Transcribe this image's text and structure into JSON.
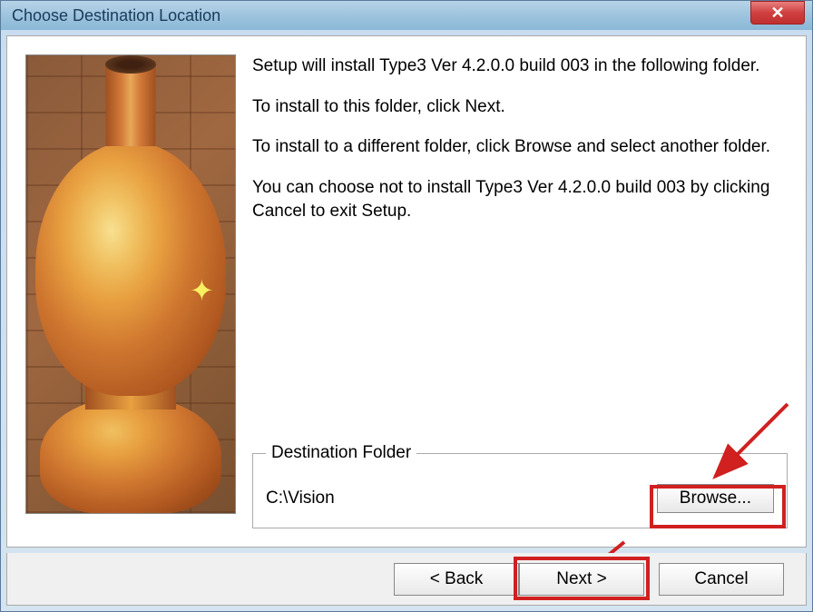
{
  "window": {
    "title": "Choose Destination Location"
  },
  "text": {
    "para1": "Setup will install Type3 Ver 4.2.0.0 build 003 in the following folder.",
    "para2": "To install to this folder, click Next.",
    "para3": "To install to a different folder, click Browse and select another folder.",
    "para4": "You can choose not to install Type3 Ver 4.2.0.0 build 003 by clicking Cancel to exit Setup."
  },
  "destination": {
    "legend": "Destination Folder",
    "path": "C:\\Vision",
    "browse_label": "Browse..."
  },
  "buttons": {
    "back": "< Back",
    "next": "Next >",
    "cancel": "Cancel"
  }
}
